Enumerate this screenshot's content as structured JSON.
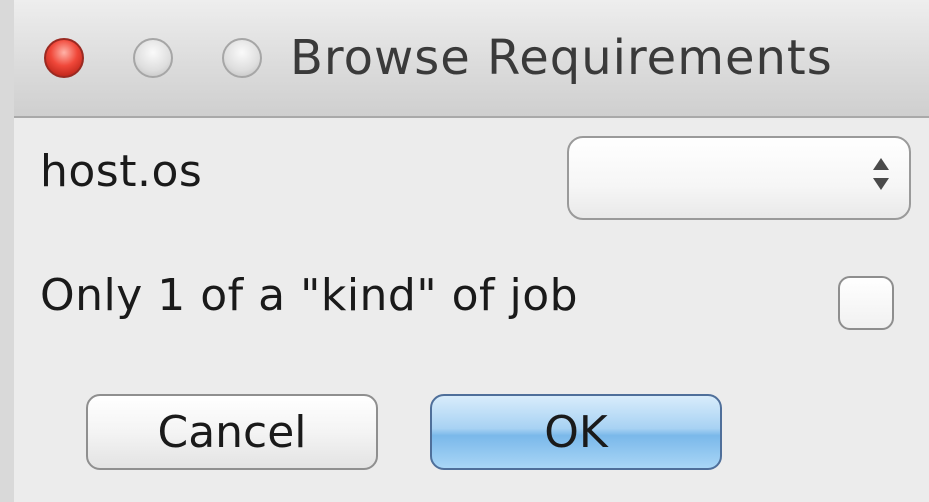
{
  "window": {
    "title": "Browse Requirements"
  },
  "form": {
    "host_os_label": "host.os",
    "host_os_value": "",
    "only_one_label": "Only 1 of a \"kind\" of job",
    "only_one_checked": false
  },
  "buttons": {
    "cancel_label": "Cancel",
    "ok_label": "OK"
  },
  "icons": {
    "close": "close-icon",
    "minimize": "minimize-icon",
    "zoom": "zoom-icon",
    "stepper": "up-down-arrows-icon"
  },
  "colors": {
    "close_button": "#f0483a",
    "default_button": "#7ab8ea",
    "window_background": "#ececec"
  }
}
